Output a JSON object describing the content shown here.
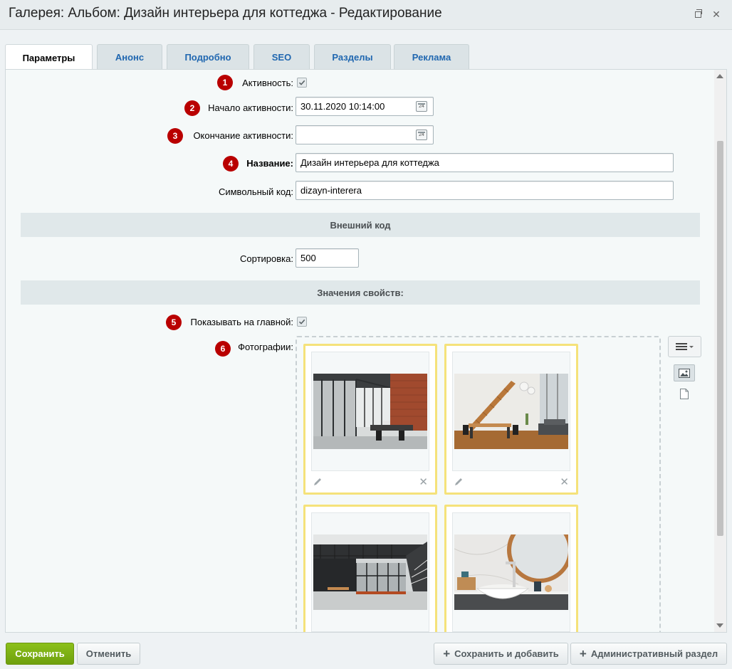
{
  "window": {
    "title": "Галерея: Альбом: Дизайн интерьера для коттеджа - Редактирование"
  },
  "tabs": [
    {
      "label": "Параметры"
    },
    {
      "label": "Анонс"
    },
    {
      "label": "Подробно"
    },
    {
      "label": "SEO"
    },
    {
      "label": "Разделы"
    },
    {
      "label": "Реклама"
    }
  ],
  "form": {
    "active": {
      "badge": "1",
      "label": "Активность:",
      "checked": true
    },
    "start": {
      "badge": "2",
      "label": "Начало активности:",
      "value": "30.11.2020 10:14:00"
    },
    "end": {
      "badge": "3",
      "label": "Окончание активности:",
      "value": ""
    },
    "name": {
      "badge": "4",
      "label": "Название:",
      "value": "Дизайн интерьера для коттеджа"
    },
    "code": {
      "label": "Символьный код:",
      "value": "dizayn-interera"
    },
    "section_external": "Внешний код",
    "sort": {
      "label": "Сортировка:",
      "value": "500"
    },
    "section_props": "Значения свойств:",
    "show_main": {
      "badge": "5",
      "label": "Показывать на главной:",
      "checked": true
    },
    "photos": {
      "badge": "6",
      "label": "Фотографии:"
    }
  },
  "calendar_icon_text": "24",
  "photos": [
    {
      "name": "office-glass-interior"
    },
    {
      "name": "loft-staircase-dining"
    },
    {
      "name": "industrial-mezzanine"
    },
    {
      "name": "bathroom-vessel-sink"
    }
  ],
  "buttons": {
    "save": "Сохранить",
    "cancel": "Отменить",
    "save_add": "Сохранить и добавить",
    "admin": "Административный раздел"
  },
  "colors": {
    "badge": "#b90000",
    "save_button": "#7fae14",
    "tab_link": "#2067b0",
    "photo_card_border": "#f5e27a"
  }
}
